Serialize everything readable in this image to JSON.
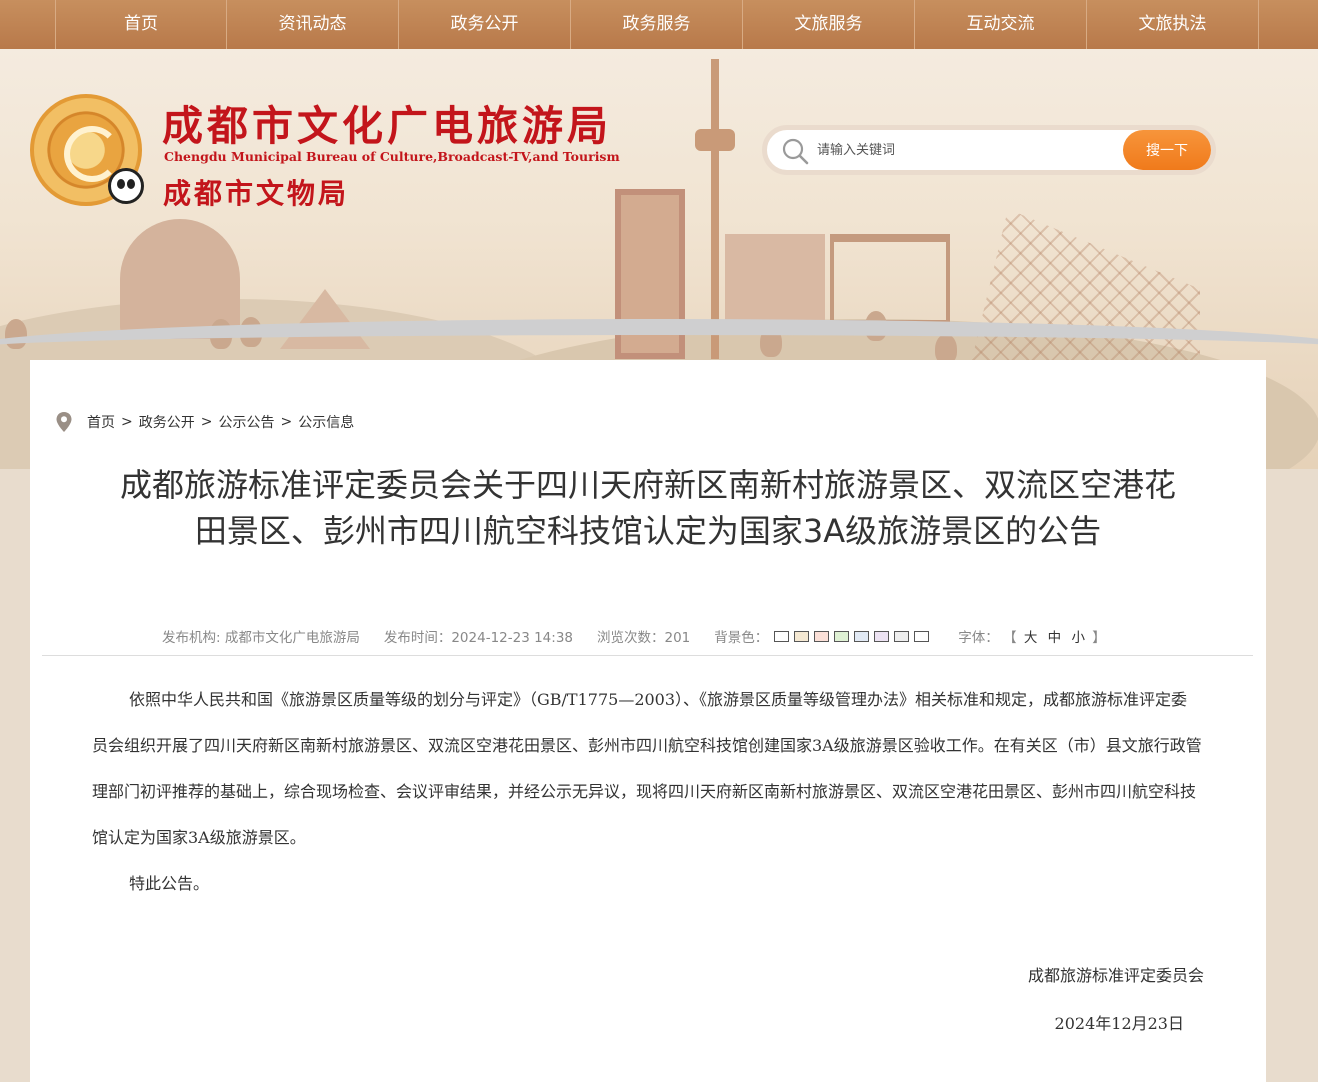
{
  "nav": {
    "items": [
      "首页",
      "资讯动态",
      "政务公开",
      "政务服务",
      "文旅服务",
      "互动交流",
      "文旅执法"
    ]
  },
  "header": {
    "title": "成都市文化广电旅游局",
    "title_en": "Chengdu Municipal Bureau of Culture,Broadcast-TV,and Tourism",
    "subtitle": "成都市文物局"
  },
  "search": {
    "placeholder": "请输入关键词",
    "button_label": "搜一下"
  },
  "breadcrumb": {
    "items": [
      "首页",
      "政务公开",
      "公示公告",
      "公示信息"
    ],
    "separator": ">"
  },
  "article": {
    "title": "成都旅游标准评定委员会关于四川天府新区南新村旅游景区、双流区空港花田景区、彭州市四川航空科技馆认定为国家3A级旅游景区的公告",
    "meta": {
      "publisher": "发布机构: 成都市文化广电旅游局",
      "publish_time": "发布时间：2024-12-23 14:38",
      "views": "浏览次数：201",
      "bg_label": "背景色：",
      "font_label": "字体：",
      "font_open": "【",
      "font_large": "大",
      "font_medium": "中",
      "font_small": "小",
      "font_close": "】"
    },
    "paragraphs": [
      "依照中华人民共和国《旅游景区质量等级的划分与评定》（GB/T1775—2003）、《旅游景区质量等级管理办法》相关标准和规定，成都旅游标准评定委员会组织开展了四川天府新区南新村旅游景区、双流区空港花田景区、彭州市四川航空科技馆创建国家3A级旅游景区验收工作。在有关区（市）县文旅行政管理部门初评推荐的基础上，综合现场检查、会议评审结果，并经公示无异议，现将四川天府新区南新村旅游景区、双流区空港花田景区、彭州市四川航空科技馆认定为国家3A级旅游景区。",
      "特此公告。"
    ],
    "signature": "成都旅游标准评定委员会",
    "date": "2024年12月23日"
  },
  "colors": {
    "nav_bg": "#b8794a",
    "brand_red": "#c3151b",
    "search_button": "#f07a1b",
    "bg_swatches": [
      "#ffffff",
      "#f5e9d3",
      "#fbe0d8",
      "#dff1d4",
      "#e2eaf5",
      "#ede3f3",
      "#eeeeee",
      "#ffffff"
    ]
  }
}
